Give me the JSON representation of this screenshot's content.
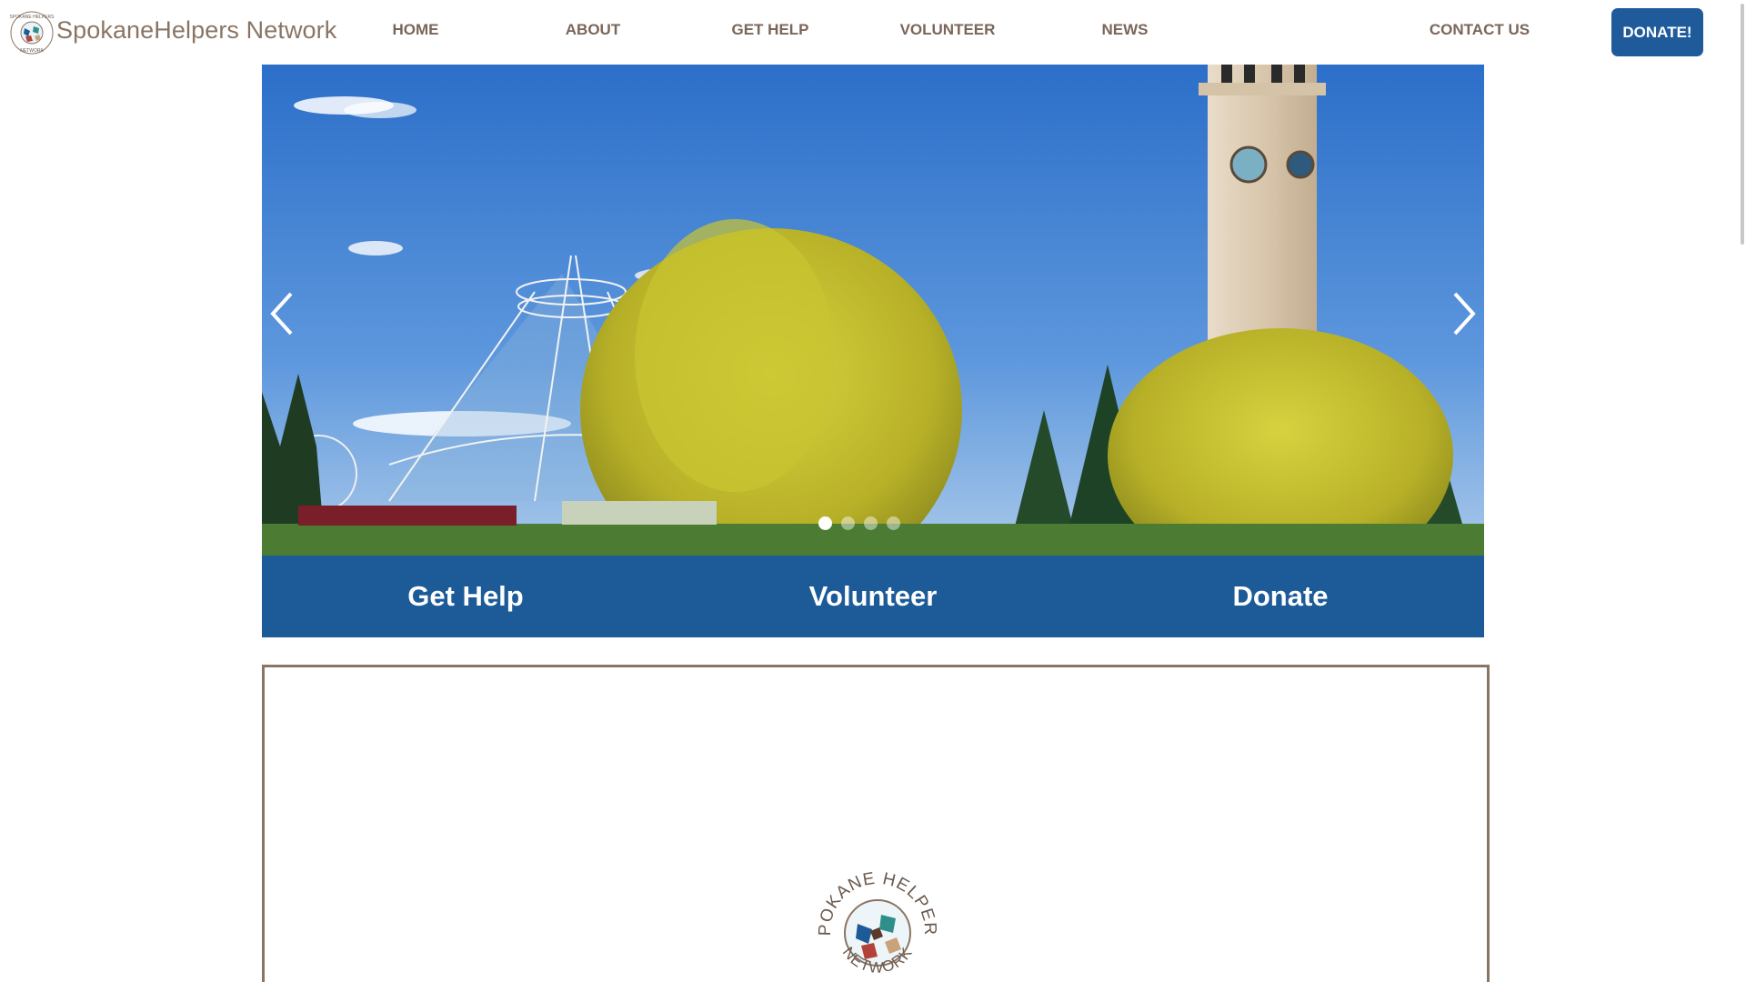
{
  "header": {
    "site_title": "SpokaneHelpers Network",
    "logo_icon": "spokane-helpers-logo-icon",
    "nav": [
      {
        "label": "HOME"
      },
      {
        "label": "ABOUT"
      },
      {
        "label": "GET HELP"
      },
      {
        "label": "VOLUNTEER"
      },
      {
        "label": "NEWS"
      },
      {
        "label": "CONTACT US"
      }
    ],
    "donate_label": "DONATE!"
  },
  "hero": {
    "slide_count": 4,
    "active_slide": 1
  },
  "actions": [
    {
      "label": "Get Help"
    },
    {
      "label": "Volunteer"
    },
    {
      "label": "Donate"
    }
  ],
  "logo_text": {
    "top": "SPOKANE HELPERS",
    "bottom": "NETWORK"
  },
  "colors": {
    "brand_blue": "#1c5a98",
    "brand_brown": "#8a7565"
  }
}
